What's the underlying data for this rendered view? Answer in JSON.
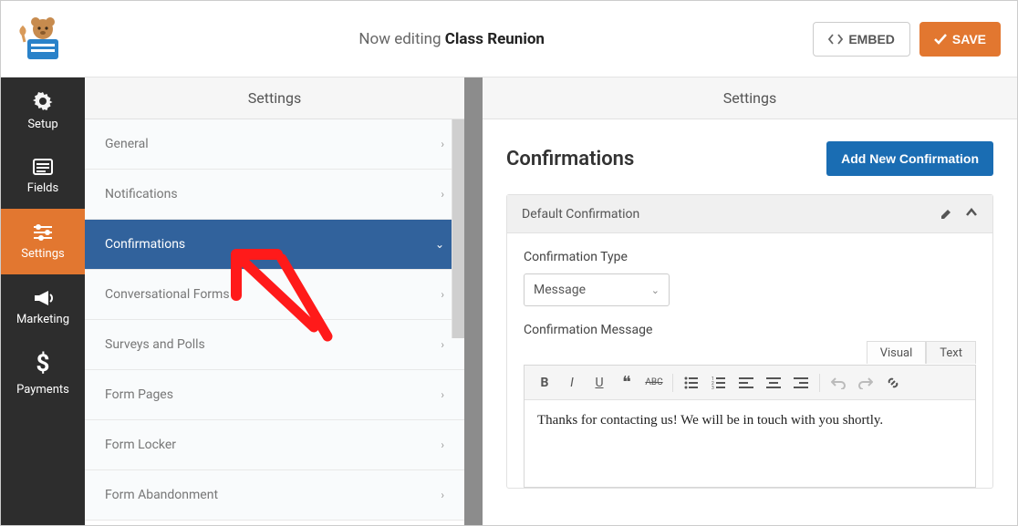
{
  "header": {
    "editing_prefix": "Now editing",
    "form_name": "Class Reunion",
    "embed_label": "EMBED",
    "save_label": "SAVE"
  },
  "rail": {
    "items": [
      {
        "label": "Setup",
        "icon": "gear-icon"
      },
      {
        "label": "Fields",
        "icon": "list-icon"
      },
      {
        "label": "Settings",
        "icon": "sliders-icon",
        "active": true
      },
      {
        "label": "Marketing",
        "icon": "bullhorn-icon"
      },
      {
        "label": "Payments",
        "icon": "dollar-icon"
      }
    ]
  },
  "settings_header": "Settings",
  "settings_items": [
    {
      "label": "General"
    },
    {
      "label": "Notifications"
    },
    {
      "label": "Confirmations",
      "selected": true
    },
    {
      "label": "Conversational Forms"
    },
    {
      "label": "Surveys and Polls"
    },
    {
      "label": "Form Pages"
    },
    {
      "label": "Form Locker"
    },
    {
      "label": "Form Abandonment"
    }
  ],
  "main": {
    "title": "Confirmations",
    "add_button": "Add New Confirmation",
    "panel_title": "Default Confirmation",
    "type_label": "Confirmation Type",
    "type_value": "Message",
    "message_label": "Confirmation Message",
    "editor_tabs": {
      "visual": "Visual",
      "text": "Text"
    },
    "editor_content": "Thanks for contacting us! We will be in touch with you shortly."
  }
}
